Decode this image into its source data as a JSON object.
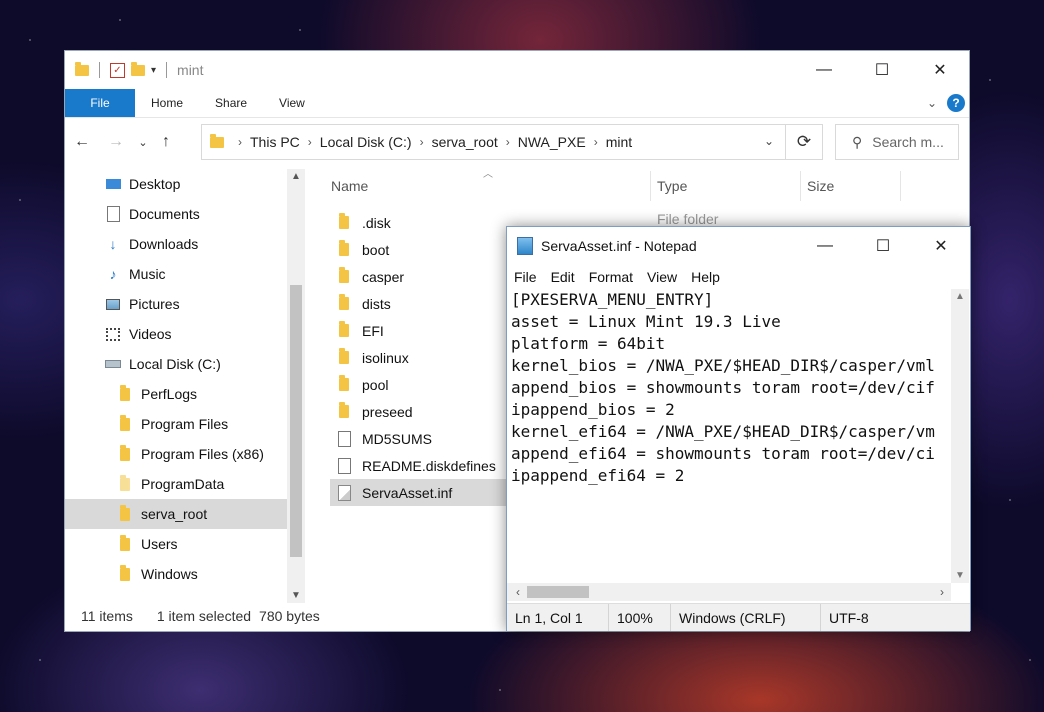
{
  "explorer": {
    "title": "mint",
    "ribbon_tabs": [
      "File",
      "Home",
      "Share",
      "View"
    ],
    "address": [
      "This PC",
      "Local Disk (C:)",
      "serva_root",
      "NWA_PXE",
      "mint"
    ],
    "search_placeholder": "Search m...",
    "nav_items": [
      {
        "label": "Desktop",
        "icon": "desktop-icon"
      },
      {
        "label": "Documents",
        "icon": "documents-icon"
      },
      {
        "label": "Downloads",
        "icon": "downloads-icon"
      },
      {
        "label": "Music",
        "icon": "music-icon"
      },
      {
        "label": "Pictures",
        "icon": "pictures-icon"
      },
      {
        "label": "Videos",
        "icon": "videos-icon"
      },
      {
        "label": "Local Disk (C:)",
        "icon": "drive-icon"
      },
      {
        "label": "PerfLogs",
        "icon": "folder-icon"
      },
      {
        "label": "Program Files",
        "icon": "folder-icon"
      },
      {
        "label": "Program Files (x86)",
        "icon": "folder-icon"
      },
      {
        "label": "ProgramData",
        "icon": "folder-icon"
      },
      {
        "label": "serva_root",
        "icon": "folder-icon"
      },
      {
        "label": "Users",
        "icon": "folder-icon"
      },
      {
        "label": "Windows",
        "icon": "folder-icon"
      }
    ],
    "selected_nav": "serva_root",
    "columns": {
      "name": "Name",
      "type": "Type",
      "size": "Size"
    },
    "files": [
      {
        "name": ".disk",
        "kind": "folder"
      },
      {
        "name": "boot",
        "kind": "folder"
      },
      {
        "name": "casper",
        "kind": "folder"
      },
      {
        "name": "dists",
        "kind": "folder"
      },
      {
        "name": "EFI",
        "kind": "folder"
      },
      {
        "name": "isolinux",
        "kind": "folder"
      },
      {
        "name": "pool",
        "kind": "folder"
      },
      {
        "name": "preseed",
        "kind": "folder"
      },
      {
        "name": "MD5SUMS",
        "kind": "file"
      },
      {
        "name": "README.diskdefines",
        "kind": "file"
      },
      {
        "name": "ServaAsset.inf",
        "kind": "inf"
      }
    ],
    "selected_file": "ServaAsset.inf",
    "first_row_type": "File folder",
    "status": {
      "items": "11 items",
      "selection": "1 item selected",
      "size": "780 bytes"
    },
    "colors": {
      "accent": "#1979ca",
      "folder": "#f4c545",
      "selection": "#d9d9d9"
    }
  },
  "notepad": {
    "title": "ServaAsset.inf - Notepad",
    "menu": [
      "File",
      "Edit",
      "Format",
      "View",
      "Help"
    ],
    "lines": [
      "[PXESERVA_MENU_ENTRY]",
      "asset = Linux Mint 19.3 Live",
      "platform = 64bit",
      "kernel_bios = /NWA_PXE/$HEAD_DIR$/casper/vml",
      "append_bios = showmounts toram root=/dev/cif",
      "ipappend_bios = 2",
      "kernel_efi64 = /NWA_PXE/$HEAD_DIR$/casper/vm",
      "append_efi64 = showmounts toram root=/dev/ci",
      "ipappend_efi64 = 2"
    ],
    "status": {
      "position": "Ln 1, Col 1",
      "zoom": "100%",
      "eol": "Windows (CRLF)",
      "encoding": "UTF-8"
    }
  }
}
